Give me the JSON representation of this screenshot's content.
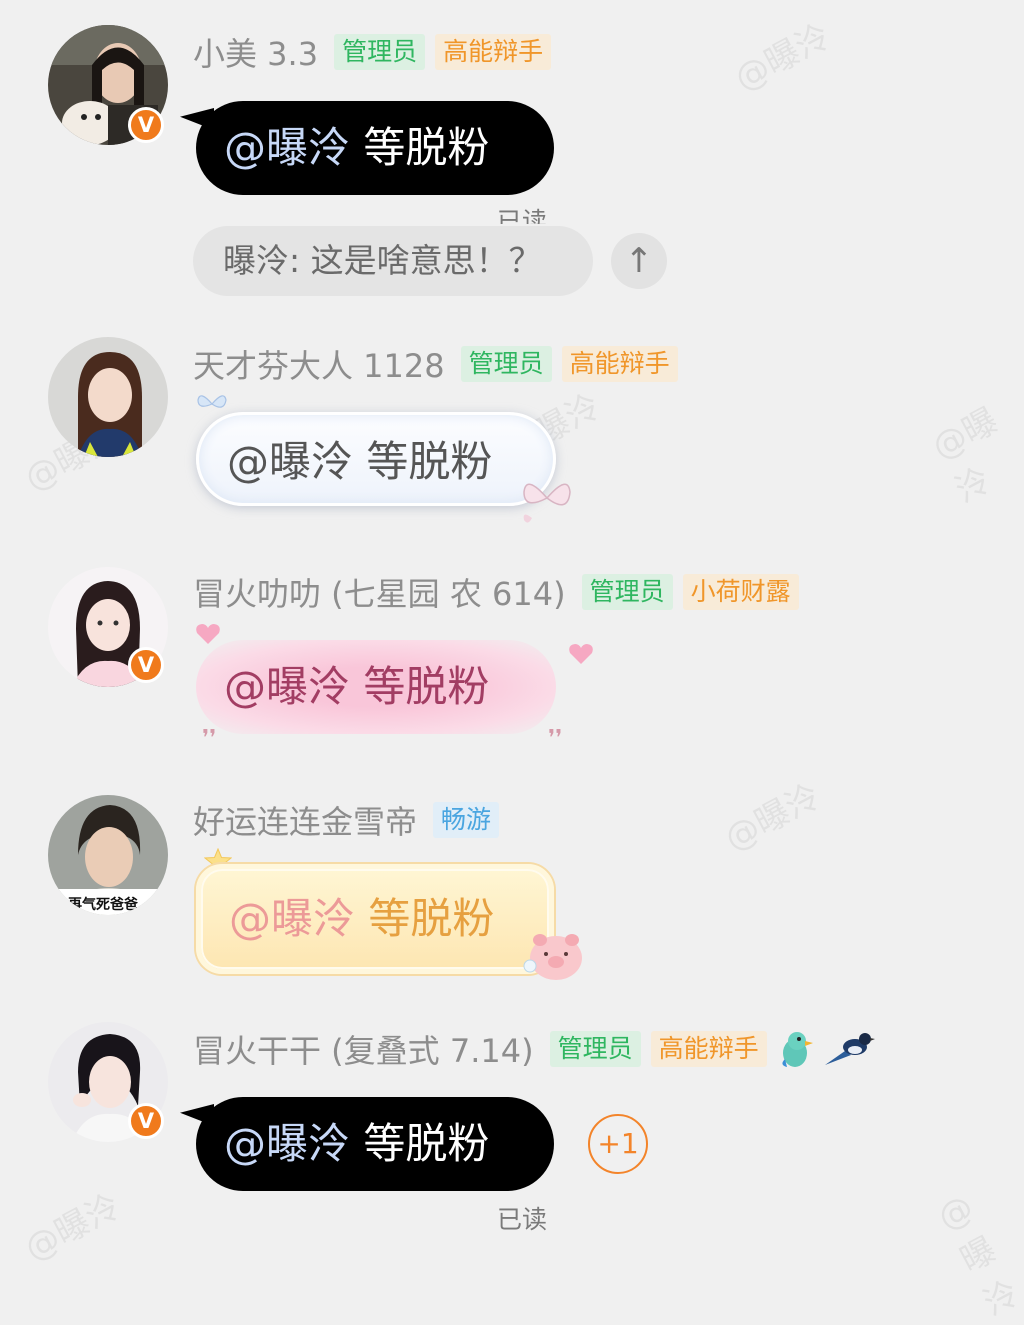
{
  "watermark": "@曝泠",
  "messages": [
    {
      "username": "小美 3.3",
      "tags": [
        "管理员",
        "高能辩手"
      ],
      "avatar": "avatar-woman-with-dog",
      "verified": "V",
      "text_at": "@曝泠",
      "text_rest": "等脱粉",
      "bubble_style": "black",
      "read_status": "已读"
    },
    {
      "username": "天才芬大人 1128",
      "tags": [
        "管理员",
        "高能辩手"
      ],
      "avatar": "avatar-girl-uniform",
      "text_at": "@曝泠",
      "text_rest": "等脱粉",
      "bubble_style": "pearl-butterfly"
    },
    {
      "username": "冒火叻叻 (七星园 农 614)",
      "tags": [
        "管理员",
        "小荷财露"
      ],
      "avatar": "avatar-girl-pink",
      "verified": "V",
      "text_at": "@曝泠",
      "text_rest": "等脱粉",
      "bubble_style": "pink-glow"
    },
    {
      "username": "好运连连金雪帝",
      "tags": [
        "畅游"
      ],
      "avatar": "avatar-boy",
      "avatar_caption": "再气死爸爸",
      "text_at": "@曝泠",
      "text_rest": "等脱粉",
      "bubble_style": "yellow-pig"
    },
    {
      "username": "冒火干干 (复叠式 7.14)",
      "tags": [
        "管理员",
        "高能辩手"
      ],
      "extra_icons": [
        "green-bird-icon",
        "magpie-icon"
      ],
      "avatar": "avatar-girl-white-hoodie",
      "verified": "V",
      "text_at": "@曝泠",
      "text_rest": "等脱粉",
      "bubble_style": "black",
      "reaction": "+1",
      "read_status": "已读"
    }
  ],
  "recall_notice": "曝泠: 这是啥意思！？",
  "scroll_top_icon": "↑",
  "colors": {
    "background": "#f0f0f0",
    "tag_green": "#2fb660",
    "tag_orange": "#f0962a",
    "tag_blue": "#4aa5e0",
    "verified_badge": "#f07a1c",
    "reaction": "#f3842a"
  }
}
